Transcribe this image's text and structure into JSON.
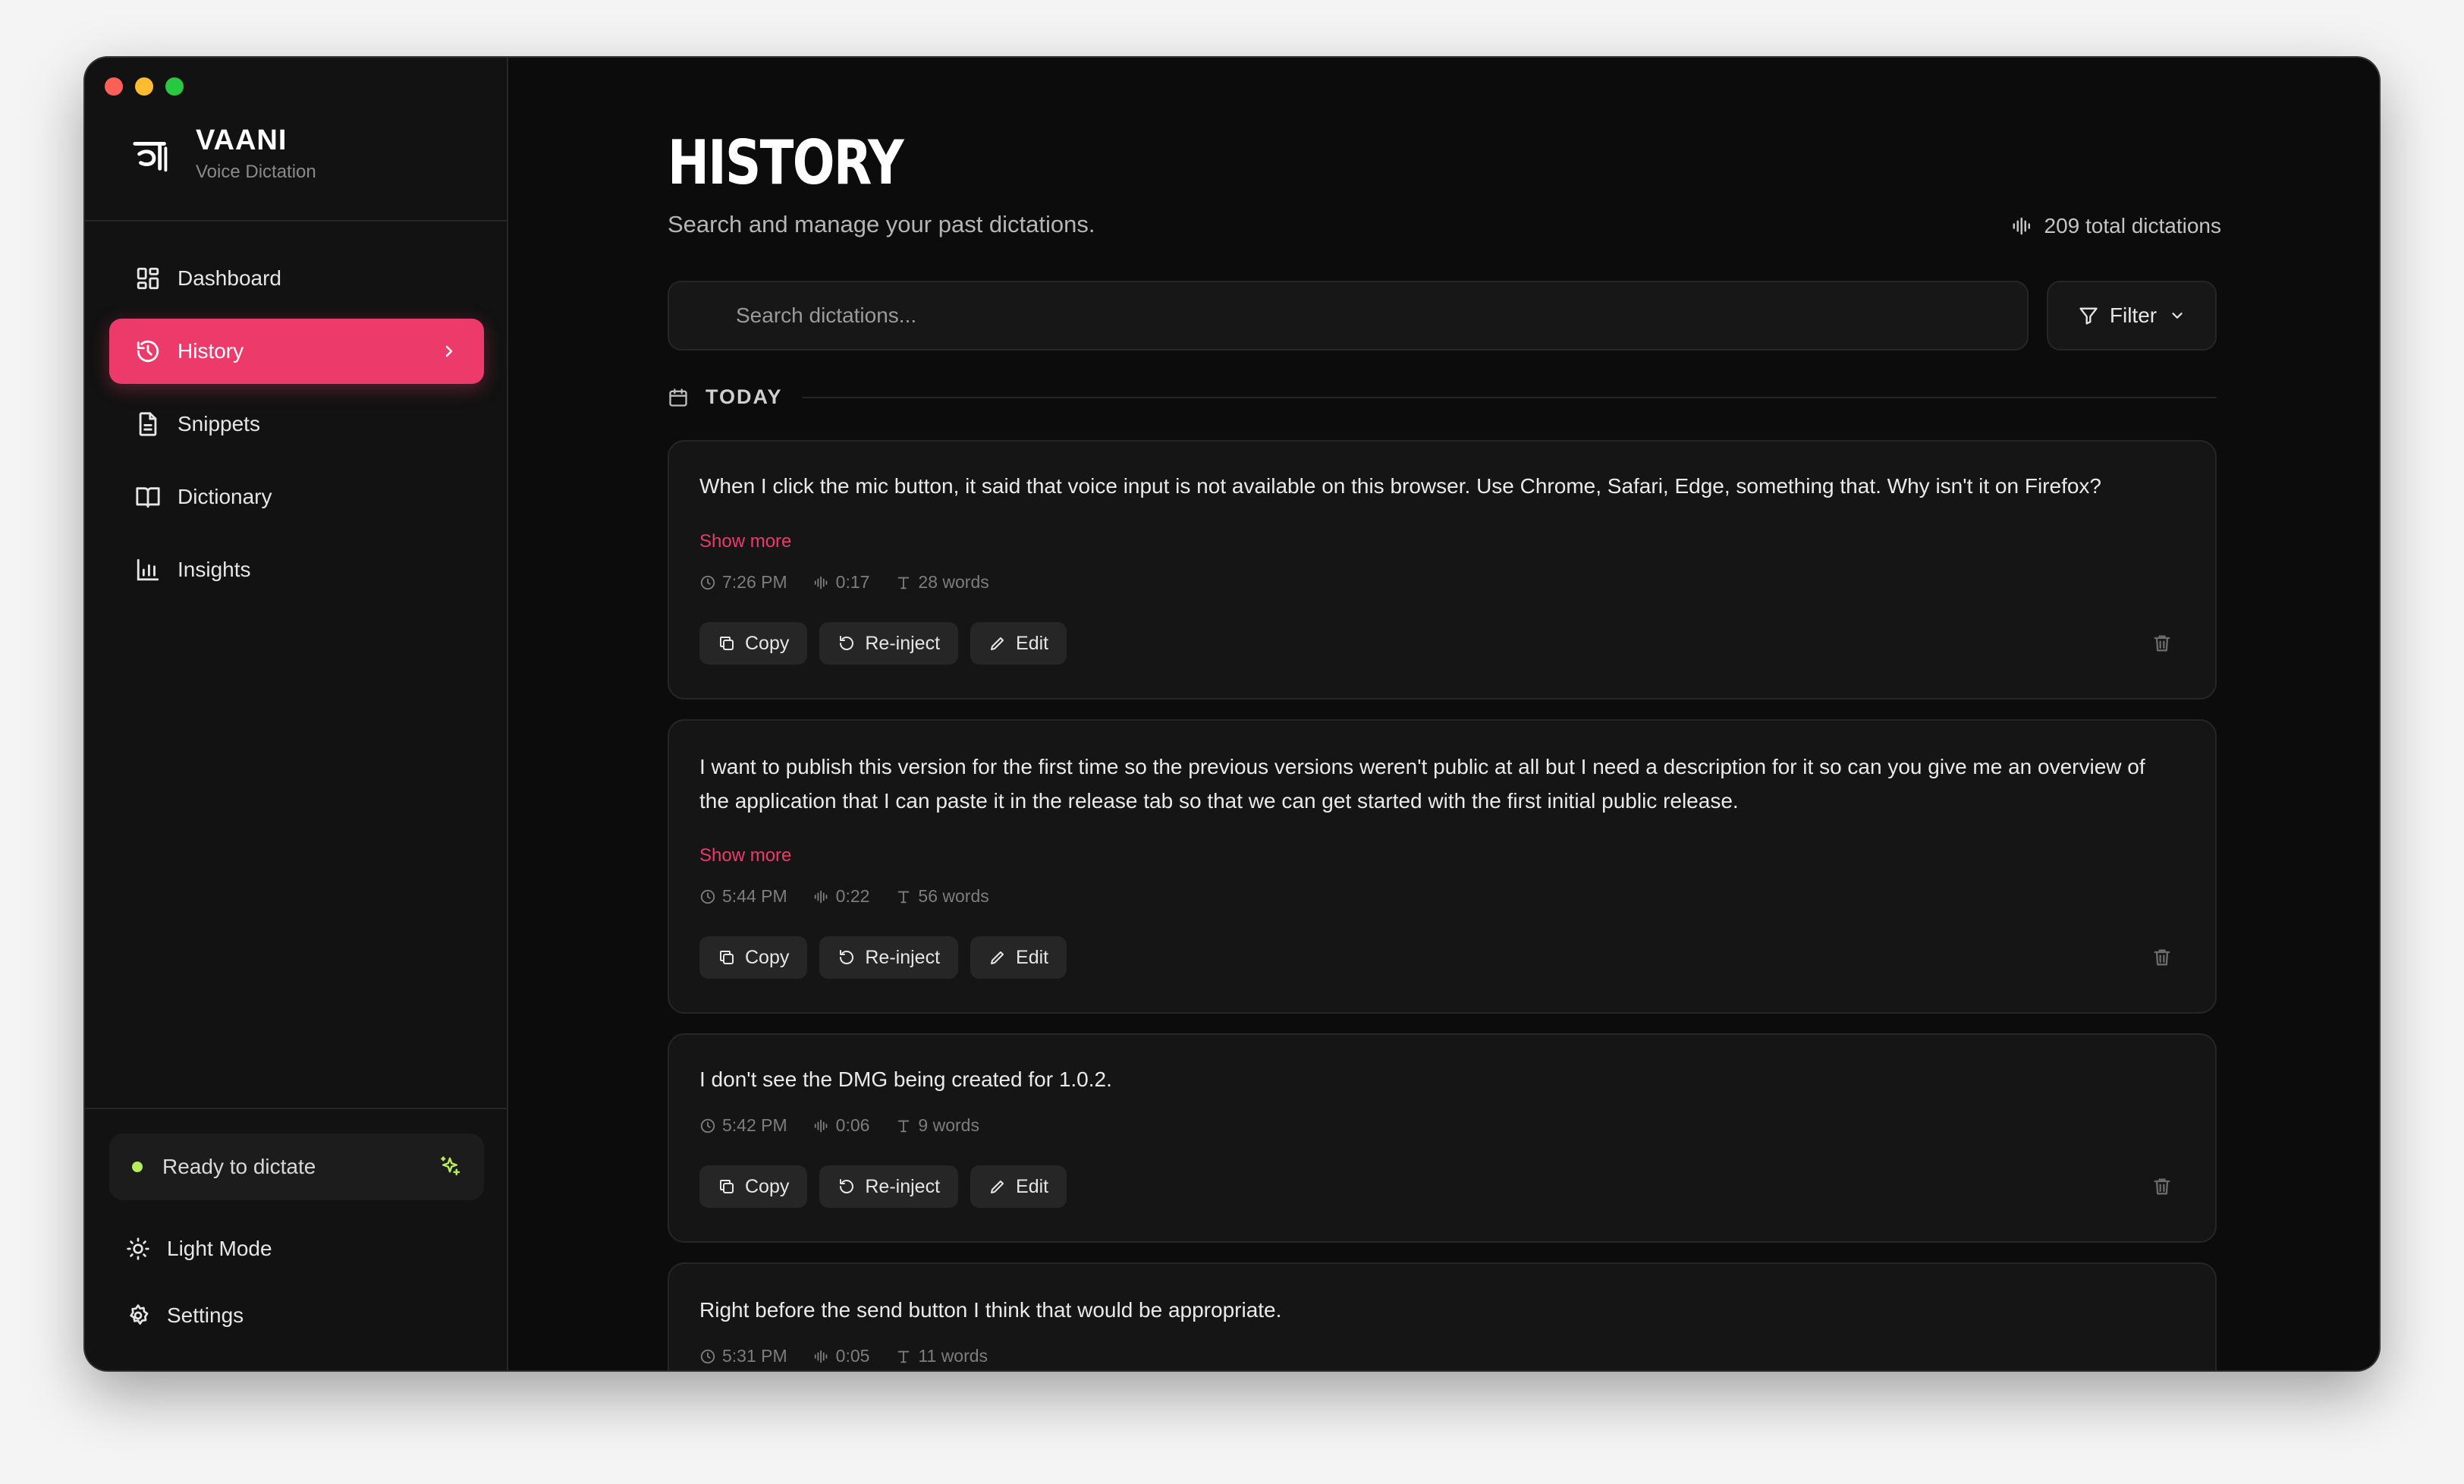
{
  "brand": {
    "name": "VAANI",
    "subtitle": "Voice Dictation"
  },
  "sidebar": {
    "items": [
      {
        "label": "Dashboard",
        "icon": "dashboard-icon"
      },
      {
        "label": "History",
        "icon": "history-icon",
        "active": true
      },
      {
        "label": "Snippets",
        "icon": "snippets-icon"
      },
      {
        "label": "Dictionary",
        "icon": "book-icon"
      },
      {
        "label": "Insights",
        "icon": "bar-chart-icon"
      }
    ],
    "status": "Ready to dictate",
    "theme_toggle": "Light Mode",
    "settings": "Settings"
  },
  "page": {
    "title": "HISTORY",
    "subtitle": "Search and manage your past dictations.",
    "total": "209 total dictations"
  },
  "search": {
    "placeholder": "Search dictations..."
  },
  "filter": {
    "label": "Filter"
  },
  "section": {
    "label": "TODAY"
  },
  "actions": {
    "copy": "Copy",
    "reinject": "Re-inject",
    "edit": "Edit",
    "show_more": "Show more"
  },
  "entries": [
    {
      "text": "When I click the mic button, it said that voice input is not available on this browser. Use Chrome, Safari, Edge, something that. Why isn't it on Firefox?",
      "time": "7:26 PM",
      "duration": "0:17",
      "words": "28 words"
    },
    {
      "text": "I want to publish this version for the first time so the previous versions weren't public at all but I need a description for it so can you give me an overview of the application that I can paste it in the release tab so that we can get started with the first initial public release.",
      "time": "5:44 PM",
      "duration": "0:22",
      "words": "56 words"
    },
    {
      "text": "I don't see the DMG being created for 1.0.2.",
      "time": "5:42 PM",
      "duration": "0:06",
      "words": "9 words"
    },
    {
      "text": "Right before the send button I think that would be appropriate.",
      "time": "5:31 PM",
      "duration": "0:05",
      "words": "11 words"
    }
  ],
  "colors": {
    "accent": "#ec3a6b",
    "status_dot": "#b7ec5b",
    "background": "#0c0c0c"
  }
}
